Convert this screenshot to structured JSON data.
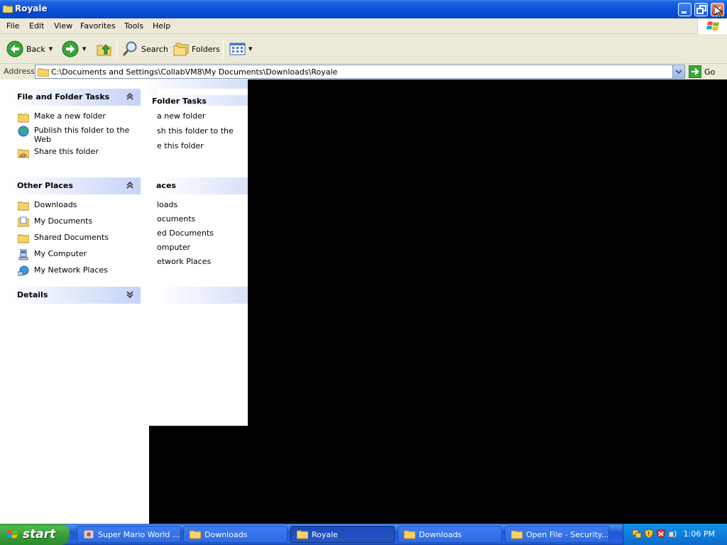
{
  "window": {
    "title": "Royale"
  },
  "menu": [
    "File",
    "Edit",
    "View",
    "Favorites",
    "Tools",
    "Help"
  ],
  "toolbar": {
    "back": "Back",
    "search": "Search",
    "folders": "Folders"
  },
  "address": {
    "label": "Address",
    "path": "C:\\Documents and Settings\\CollabVM8\\My Documents\\Downloads\\Royale",
    "go": "Go"
  },
  "taskpane": {
    "file_tasks": {
      "title": "File and Folder Tasks",
      "items": [
        "Make a new folder",
        "Publish this folder to the Web",
        "Share this folder"
      ]
    },
    "other_places": {
      "title": "Other Places",
      "items": [
        "Downloads",
        "My Documents",
        "Shared Documents",
        "My Computer",
        "My Network Places"
      ]
    },
    "details": {
      "title": "Details"
    }
  },
  "ghost": {
    "file_tasks_title": "Folder Tasks",
    "file_items": [
      "a new folder",
      "sh this folder to the",
      "e this folder"
    ],
    "other_title": "aces",
    "other_items": [
      "loads",
      "ocuments",
      "ed Documents",
      "omputer",
      "etwork Places"
    ]
  },
  "taskbar": {
    "start": "start",
    "buttons": [
      "Super Mario World ...",
      "Downloads",
      "Royale",
      "Downloads",
      "Open File - Security..."
    ],
    "clock": "1:06 PM"
  },
  "colors": {
    "title_bar": "#0a52d8",
    "taskbar": "#2157d7",
    "start_green": "#3c9a3c"
  }
}
